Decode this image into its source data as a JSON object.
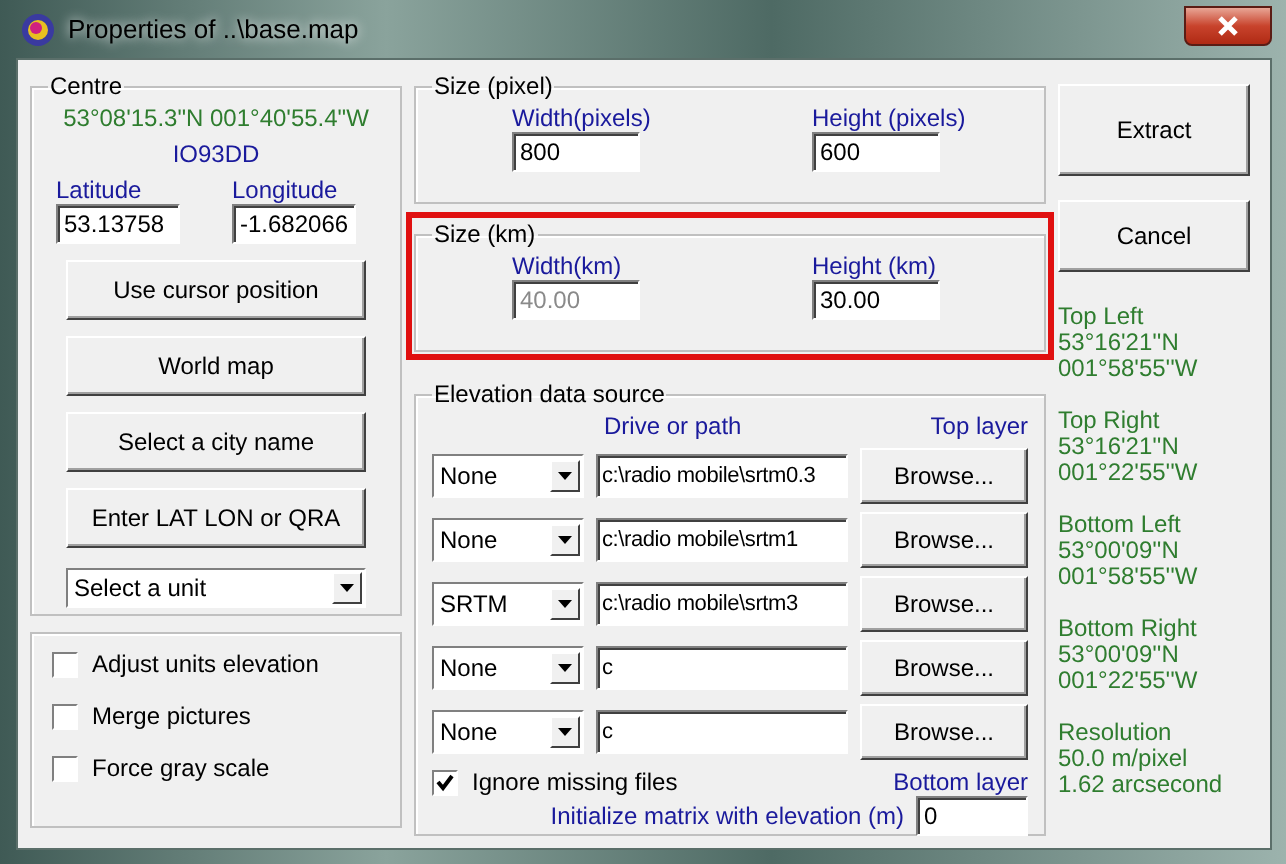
{
  "window": {
    "title": "Properties of ..\\base.map"
  },
  "centre": {
    "title": "Centre",
    "coordinates": "53°08'15.3\"N 001°40'55.4\"W",
    "locator": "IO93DD",
    "latitude": {
      "label": "Latitude",
      "value": "53.13758"
    },
    "longitude": {
      "label": "Longitude",
      "value": "-1.682066"
    },
    "buttons": [
      "Use cursor position",
      "World map",
      "Select a city name",
      "Enter LAT LON or QRA"
    ],
    "unit_select": {
      "value": "Select a unit"
    }
  },
  "options": [
    {
      "label": "Adjust units elevation",
      "checked": false
    },
    {
      "label": "Merge pictures",
      "checked": false
    },
    {
      "label": "Force gray scale",
      "checked": false
    }
  ],
  "size_pixel": {
    "title": "Size (pixel)",
    "fields": [
      {
        "label": "Width(pixels)",
        "value": "800",
        "disabled": false
      },
      {
        "label": "Height (pixels)",
        "value": "600",
        "disabled": false
      }
    ]
  },
  "size_km": {
    "title": "Size (km)",
    "highlighted": true,
    "fields": [
      {
        "label": "Width(km)",
        "value": "40.00",
        "disabled": true
      },
      {
        "label": "Height (km)",
        "value": "30.00",
        "disabled": false
      }
    ]
  },
  "elevation": {
    "title": "Elevation data source",
    "path_heading": "Drive or path",
    "top_label": "Top layer",
    "bottom_label": "Bottom layer",
    "layers": [
      {
        "source": "None",
        "path": "c:\\radio mobile\\srtm0.3",
        "button": "Browse..."
      },
      {
        "source": "None",
        "path": "c:\\radio mobile\\srtm1",
        "button": "Browse..."
      },
      {
        "source": "SRTM",
        "path": "c:\\radio mobile\\srtm3",
        "button": "Browse..."
      },
      {
        "source": "None",
        "path": "c",
        "button": "Browse..."
      },
      {
        "source": "None",
        "path": "c",
        "button": "Browse..."
      }
    ],
    "ignore_missing": {
      "label": "Ignore missing files",
      "checked": true
    },
    "init": {
      "label": "Initialize matrix with elevation (m)",
      "value": "0"
    }
  },
  "actions": [
    "Extract",
    "Cancel"
  ],
  "info": [
    {
      "title": "Top Left",
      "lines": [
        "53°16'21''N",
        "001°58'55''W"
      ]
    },
    {
      "title": "Top Right",
      "lines": [
        "53°16'21''N",
        "001°22'55''W"
      ]
    },
    {
      "title": "Bottom Left",
      "lines": [
        "53°00'09''N",
        "001°58'55''W"
      ]
    },
    {
      "title": "Bottom Right",
      "lines": [
        "53°00'09''N",
        "001°22'55''W"
      ]
    },
    {
      "title": "Resolution",
      "lines": [
        "50.0 m/pixel",
        "1.62 arcsecond"
      ]
    }
  ]
}
